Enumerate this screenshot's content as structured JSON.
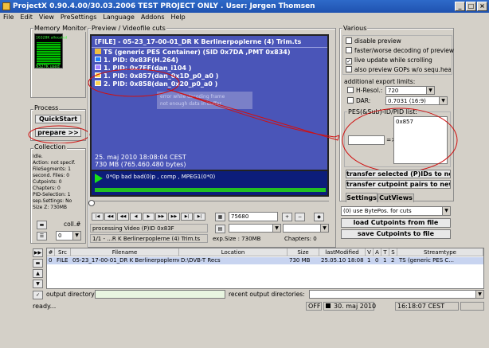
{
  "window": {
    "title": "ProjectX 0.90.4.00/30.03.2006 TEST PROJECT ONLY . User: Jørgen Thomsen",
    "minimize": "_",
    "maximize": "□",
    "close": "×"
  },
  "menu": [
    "File",
    "Edit",
    "View",
    "PreSettings",
    "Language",
    "Addons",
    "Help"
  ],
  "memory_monitor": {
    "title": "Memory Monitor",
    "allocated": "16328K allocated",
    "used": "9327K used"
  },
  "process": {
    "title": "Process",
    "quickstart": "QuickStart",
    "prepare": "prepare >>"
  },
  "collection": {
    "title": "Collection",
    "info": [
      "Idle.",
      "Action: not specif.",
      "FileSegments: 1",
      "second. Files: 0",
      "Cutpoints: 0",
      "Chapters: 0",
      "PID-Selection: 1",
      "sep.Settings: No",
      "Size Z: 730MB"
    ],
    "coll_label": "coll.#",
    "coll_value": "0"
  },
  "preview": {
    "title": "Preview / Videofile cuts",
    "file_line": "[FILE] - 05-23_17-00-01_DR K Berlinerpoplerne (4) Trim.ts",
    "ts_line": "TS (generic PES Container) (SID 0x7DA ,PMT 0x834)",
    "pids": [
      {
        "text": "1. PID: 0x83F(H.264)",
        "color": "#4fc3f7"
      },
      {
        "text": "1. PID: 0x7EF(dan_i104 )",
        "color": "#9575cd"
      },
      {
        "text": "1. PID: 0x857(dan_0x1D_p0_a0 )",
        "color": "#ffd54f"
      },
      {
        "text": "2. PID: 0x858(dan_0x20_p0_a0 )",
        "color": "#ffd54f"
      }
    ],
    "notice_1": "error while decoding frame",
    "notice_2": "not enough data in buffer",
    "date_line": "25. maj 2010   18:08:04 CEST",
    "size_line": "730 MB (765.460.480 bytes)",
    "status_line": "0*0p bad bad(0)p , comp , MPEG1(0*0)"
  },
  "controls": {
    "position_value": "75680",
    "processing_label": "processing Video (P)ID 0x83F",
    "file_label": "1/1 - ...R K Berlinerpoplerne (4) Trim.ts",
    "exp_size": "exp.Size : 730MB",
    "chapters": "Chapters:   0"
  },
  "various": {
    "title": "Various",
    "checkboxes": [
      {
        "label": "disable preview",
        "checked": false
      },
      {
        "label": "faster/worse decoding of preview",
        "checked": false
      },
      {
        "label": "live update while scrolling",
        "checked": true
      },
      {
        "label": "also preview GOPs w/o sequ.hea...",
        "checked": false
      }
    ],
    "export_limits_title": "additional export limits:",
    "hresol_label": "H-Resol.:",
    "hresol_value": "720",
    "dar_label": "DAR:",
    "dar_value": "0.7031 (16:9)",
    "pes_title": "PES(&Sub)-ID/PID list:",
    "pid_list_item": "0x857",
    "arrow": "=>",
    "transfer_pids": "transfer selected (P)IDs to new...",
    "transfer_cut": "transfer cutpoint pairs to new ...",
    "tab_settings": "Settings",
    "tab_cutviews": "CutViews"
  },
  "cutpoints": {
    "bytepos": "(0) use BytePos. for cuts",
    "load": "load Cutpoints from file",
    "save": "save Cutpoints to file"
  },
  "table": {
    "headers": [
      "#",
      "Src",
      "Filename",
      "Location",
      "Size",
      "lastModified",
      "V",
      "A",
      "T",
      "S",
      "Streamtype"
    ],
    "row": [
      "0",
      "FILE",
      "05-23_17-00-01_DR K Berlinerpoplerne...",
      "D:\\DVB-T Recs",
      "730 MB",
      "25.05.10   18:08",
      "1",
      "0",
      "1",
      "2",
      "TS (generic PES C..."
    ]
  },
  "output": {
    "dir_label": "output directory:",
    "recent_label": "recent output directories:"
  },
  "status": {
    "text": "ready...",
    "off": "OFF",
    "date": "30. maj 2010",
    "time": "16:18:07 CEST"
  }
}
